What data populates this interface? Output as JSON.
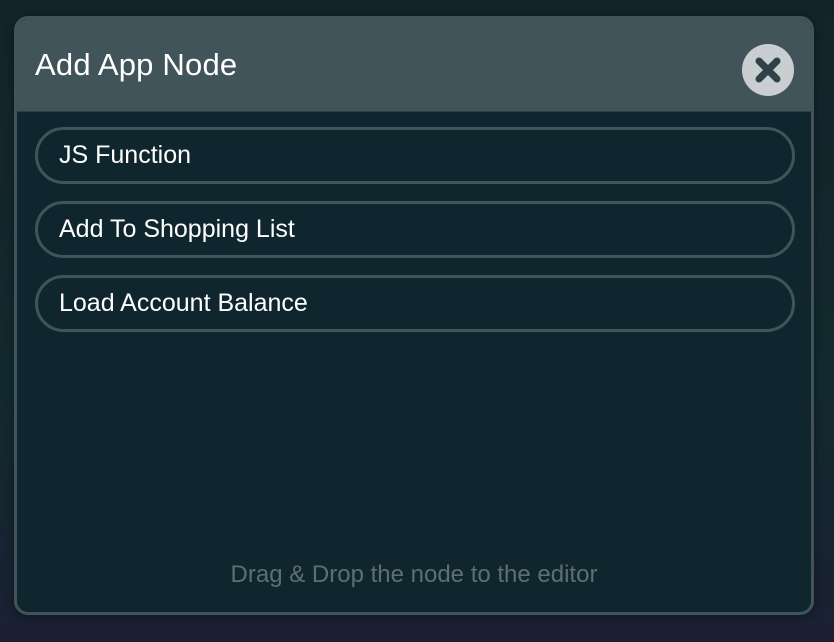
{
  "dialog": {
    "title": "Add App Node",
    "close_icon": "close-x-icon",
    "hint": "Drag & Drop the node to the editor"
  },
  "nodes": [
    {
      "label": "JS Function"
    },
    {
      "label": "Add To Shopping List"
    },
    {
      "label": "Load Account Balance"
    }
  ],
  "colors": {
    "background": "#10262e",
    "header": "#415459",
    "border": "#415459",
    "text": "#ffffff",
    "hint_text": "#5e6f73",
    "close_button_bg": "#c9cfd1",
    "close_icon": "#2f4247"
  }
}
